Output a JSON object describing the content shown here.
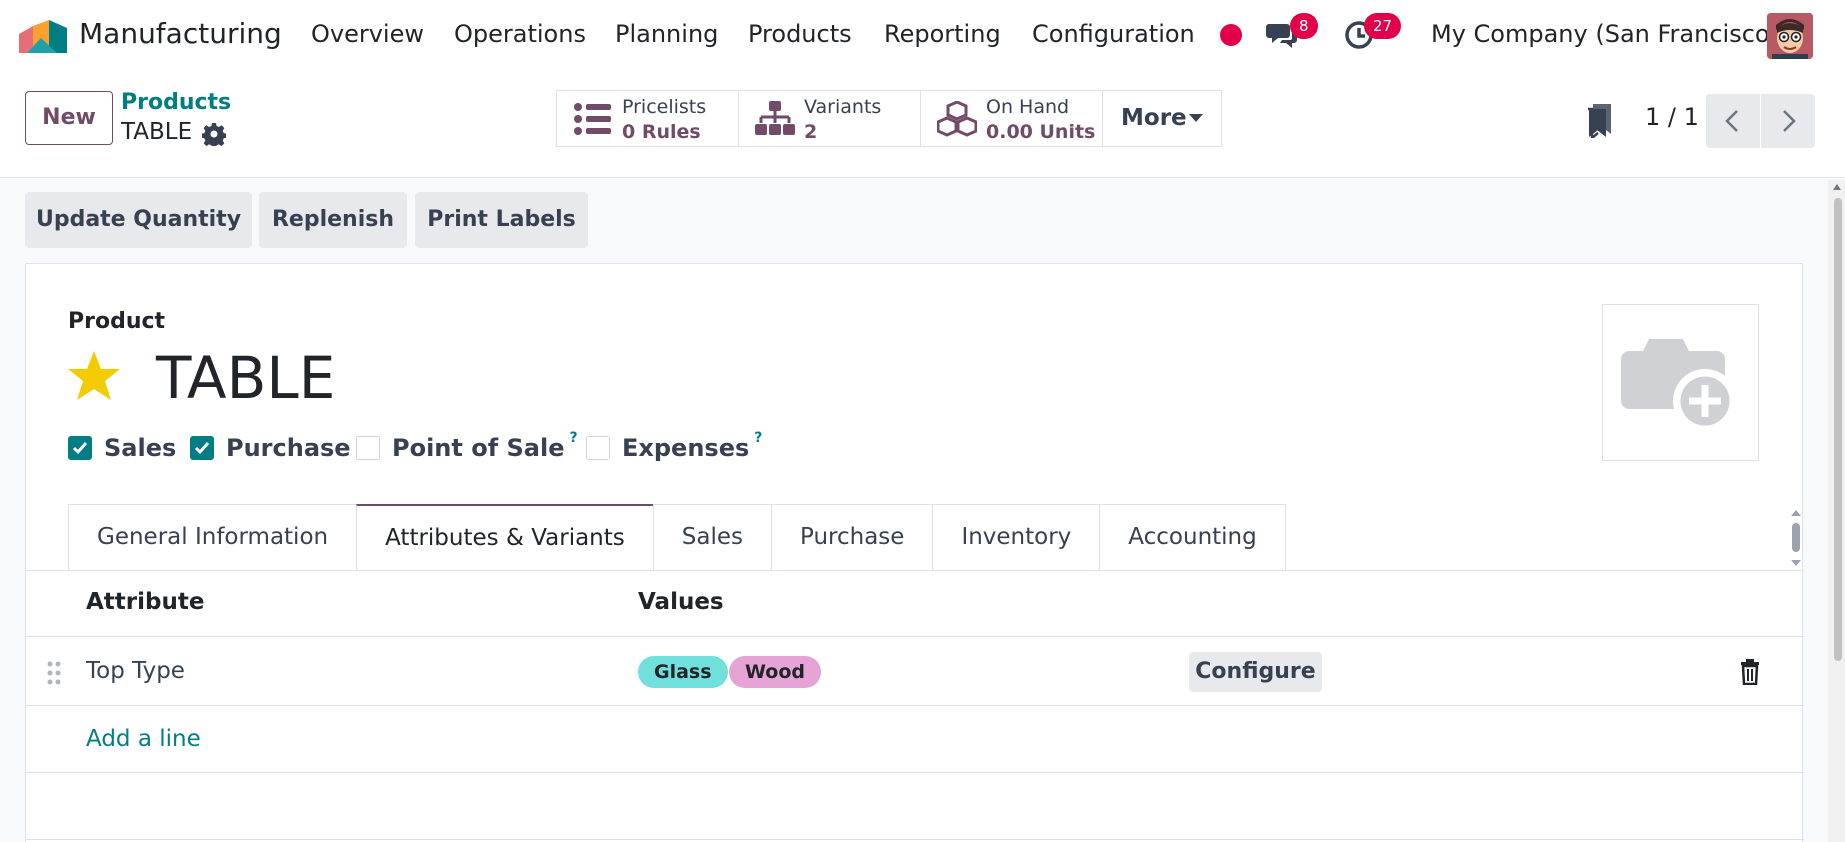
{
  "navbar": {
    "app_name": "Manufacturing",
    "menu": [
      "Overview",
      "Operations",
      "Planning",
      "Products",
      "Reporting",
      "Configuration"
    ],
    "messages_count": "8",
    "activities_count": "27",
    "company": "My Company (San Francisco)"
  },
  "control": {
    "new_label": "New",
    "breadcrumb_parent": "Products",
    "breadcrumb_current": "TABLE",
    "smart_buttons": [
      {
        "icon": "list-icon",
        "title": "Pricelists",
        "value": "0  Rules"
      },
      {
        "icon": "sitemap-icon",
        "title": "Variants",
        "value": "2"
      },
      {
        "icon": "cubes-icon",
        "title": "On Hand",
        "value": "0.00 Units"
      }
    ],
    "more_label": "More",
    "pager": "1 / 1"
  },
  "actions": [
    "Update Quantity",
    "Replenish",
    "Print Labels"
  ],
  "form": {
    "product_label": "Product",
    "product_name": "TABLE",
    "favorite": true,
    "checkboxes": [
      {
        "label": "Sales",
        "checked": true,
        "help": ""
      },
      {
        "label": "Purchase",
        "checked": true,
        "help": ""
      },
      {
        "label": "Point of Sale",
        "checked": false,
        "help": "?"
      },
      {
        "label": "Expenses",
        "checked": false,
        "help": "?"
      }
    ],
    "tabs": [
      "General Information",
      "Attributes & Variants",
      "Sales",
      "Purchase",
      "Inventory",
      "Accounting"
    ],
    "active_tab": "Attributes & Variants"
  },
  "attributes": {
    "headers": {
      "attribute": "Attribute",
      "values": "Values"
    },
    "rows": [
      {
        "attribute": "Top Type",
        "values": [
          {
            "label": "Glass",
            "color": "#6fe0dc"
          },
          {
            "label": "Wood",
            "color": "#e6a3d6"
          }
        ],
        "configure_label": "Configure"
      }
    ],
    "add_line": "Add a line"
  },
  "colors": {
    "brand": "#714b67",
    "accent": "#017e84",
    "badge": "#e2004a",
    "star": "#f3cc00"
  }
}
